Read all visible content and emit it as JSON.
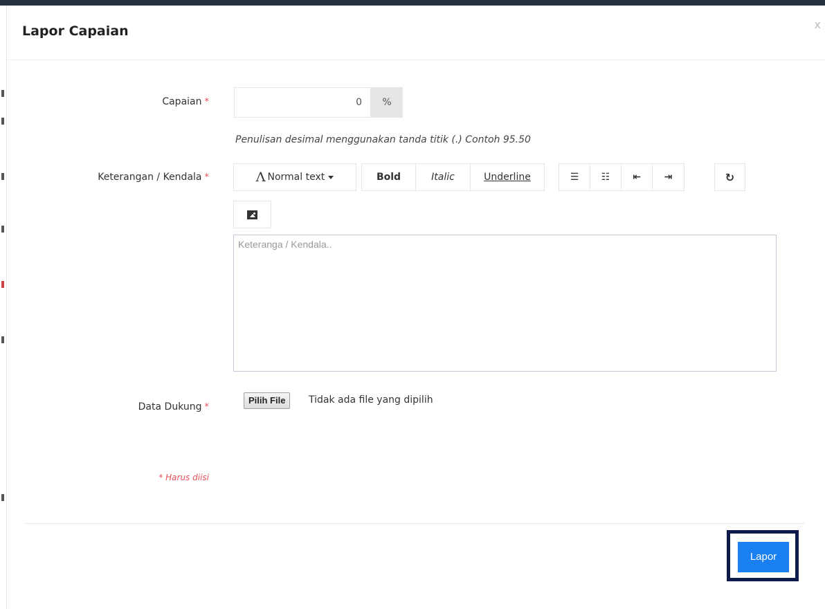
{
  "modal": {
    "title": "Lapor Capaian",
    "close_label": "x"
  },
  "form": {
    "capaian": {
      "label": "Capaian",
      "required_marker": "*",
      "value": "0",
      "addon": "%",
      "help": "Penulisan desimal menggunakan tanda titik (.) Contoh 95.50"
    },
    "keterangan": {
      "label": "Keterangan / Kendala",
      "required_marker": "*",
      "placeholder": "Keteranga / Kendala.."
    },
    "toolbar": {
      "normal_text": "Normal text",
      "bold": "Bold",
      "italic": "Italic",
      "underline": "Underline"
    },
    "data_dukung": {
      "label": "Data Dukung",
      "required_marker": "*",
      "choose_file": "Pilih File",
      "status": "Tidak ada file yang dipilih"
    },
    "required_note": "* Harus diisi"
  },
  "footer": {
    "submit_label": "Lapor"
  },
  "colors": {
    "accent": "#1a7ff0",
    "required": "#e7505a",
    "highlight": "#0d1b4a"
  }
}
